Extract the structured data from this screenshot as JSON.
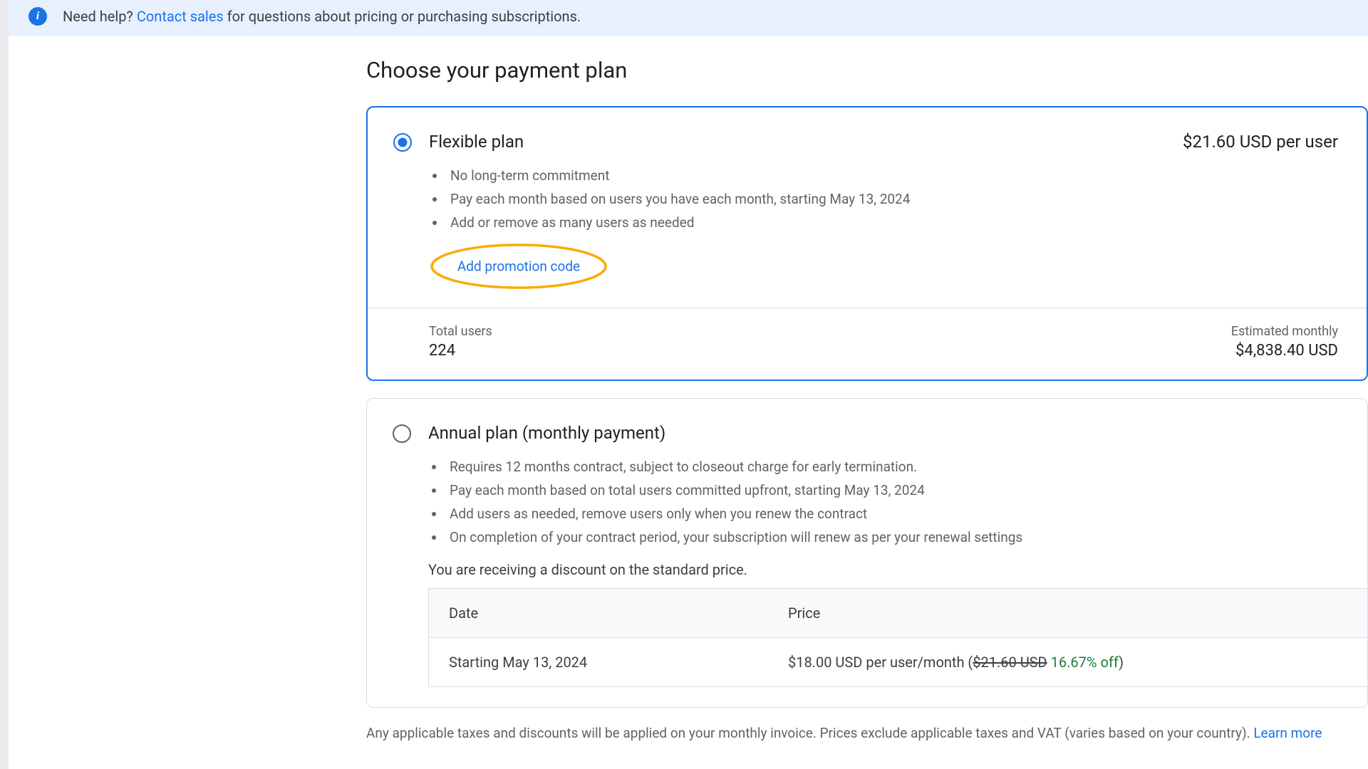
{
  "banner": {
    "prefix": "Need help? ",
    "link": "Contact sales",
    "suffix": " for questions about pricing or purchasing subscriptions."
  },
  "title": "Choose your payment plan",
  "plans": {
    "flexible": {
      "name": "Flexible plan",
      "price": "$21.60 USD per user",
      "bullets": [
        "No long-term commitment",
        "Pay each month based on users you have each month, starting May 13, 2024",
        "Add or remove as many users as needed"
      ],
      "promo_link": "Add promotion code",
      "total_users_label": "Total users",
      "total_users_value": "224",
      "est_cost_label": "Estimated monthly",
      "est_cost_value": "$4,838.40 USD"
    },
    "annual": {
      "name": "Annual plan (monthly payment)",
      "bullets": [
        "Requires 12 months contract, subject to closeout charge for early termination.",
        "Pay each month based on total users committed upfront, starting May 13, 2024",
        "Add users as needed, remove users only when you renew the contract",
        "On completion of your contract period, your subscription will renew as per your renewal settings"
      ],
      "discount_note": "You are receiving a discount on the standard price.",
      "table": {
        "header_date": "Date",
        "header_price": "Price",
        "row_date": "Starting May 13, 2024",
        "row_price_main": "$18.00 USD per user/month (",
        "row_price_strike": "$21.60 USD",
        "row_price_pct": " 16.67% off",
        "row_price_close": ")"
      }
    }
  },
  "footer": {
    "text": "Any applicable taxes and discounts will be applied on your monthly invoice. Prices exclude applicable taxes and VAT (varies based on your country). ",
    "link": "Learn more"
  }
}
